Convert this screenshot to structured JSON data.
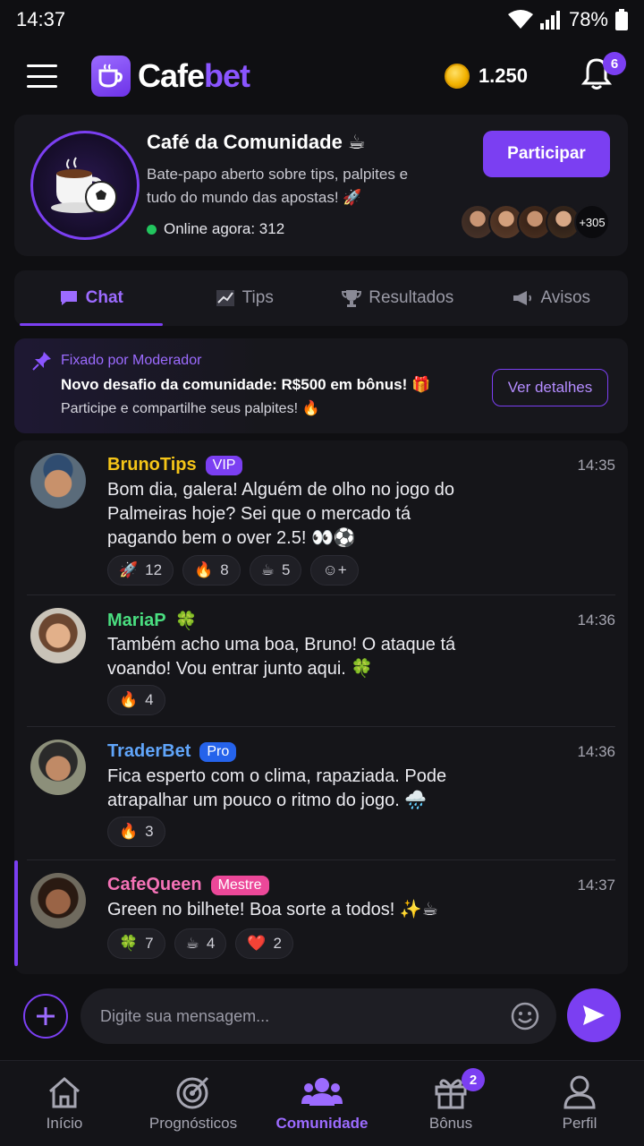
{
  "status": {
    "time": "14:37",
    "battery": "78%"
  },
  "header": {
    "logo_a": "Cafe",
    "logo_b": "bet",
    "coins": "1.250",
    "notif_count": "6"
  },
  "community": {
    "title": "Café da Comunidade ☕",
    "description": "Bate-papo aberto sobre tips, palpites e tudo do mundo das apostas! 🚀",
    "online": "Online agora: 312",
    "join_label": "Participar",
    "more_members": "+305",
    "member_colors": [
      "#8a5a3c",
      "#a86b4a",
      "#c08860",
      "#9c6a50"
    ]
  },
  "tabs": [
    {
      "icon": "💬",
      "label": "Chat"
    },
    {
      "icon": "📈",
      "label": "Tips"
    },
    {
      "icon": "🏆",
      "label": "Resultados"
    },
    {
      "icon": "📢",
      "label": "Avisos"
    }
  ],
  "pinned": {
    "label": "Fixado por Moderador",
    "title": "Novo desafio da comunidade: R$500 em bônus! 🎁",
    "subtitle": "Participe e compartilhe seus palpites! 🔥",
    "button": "Ver detalhes"
  },
  "messages": [
    {
      "name": "BrunoTips",
      "name_color": "#f5c518",
      "badge": "VIP",
      "badge_color": "#7b3ff2",
      "time": "14:35",
      "text": "Bom dia, galera! Alguém de olho no jogo do Palmeiras hoje? Sei que o mercado tá pagando bem o over 2.5! 👀⚽",
      "reactions": [
        {
          "emoji": "🚀",
          "count": "12"
        },
        {
          "emoji": "🔥",
          "count": "8"
        },
        {
          "emoji": "☕",
          "count": "5"
        },
        {
          "emoji": "☺+",
          "count": ""
        }
      ]
    },
    {
      "name": "MariaP",
      "name_color": "#4ade80",
      "badge": "🍀",
      "badge_color": "transparent",
      "time": "14:36",
      "text": "Também acho uma boa, Bruno! O ataque tá voando! Vou entrar junto aqui. 🍀",
      "reactions": [
        {
          "emoji": "🔥",
          "count": "4"
        }
      ]
    },
    {
      "name": "TraderBet",
      "name_color": "#60a5fa",
      "badge": "Pro",
      "badge_color": "#2563eb",
      "time": "14:36",
      "text": "Fica esperto com o clima, rapaziada. Pode atrapalhar um pouco o ritmo do jogo. 🌧️",
      "reactions": [
        {
          "emoji": "🔥",
          "count": "3"
        }
      ]
    },
    {
      "name": "CafeQueen",
      "name_color": "#f472b6",
      "badge": "Mestre",
      "badge_color": "#ec4899",
      "time": "14:37",
      "text": "Green no bilhete! Boa sorte a todos! ✨☕",
      "reactions": [
        {
          "emoji": "🍀",
          "count": "7"
        },
        {
          "emoji": "☕",
          "count": "4"
        },
        {
          "emoji": "❤️",
          "count": "2"
        }
      ]
    }
  ],
  "composer": {
    "placeholder": "Digite sua mensagem..."
  },
  "nav": [
    {
      "label": "Início"
    },
    {
      "label": "Prognósticos"
    },
    {
      "label": "Comunidade"
    },
    {
      "label": "Bônus",
      "badge": "2"
    },
    {
      "label": "Perfil"
    }
  ]
}
